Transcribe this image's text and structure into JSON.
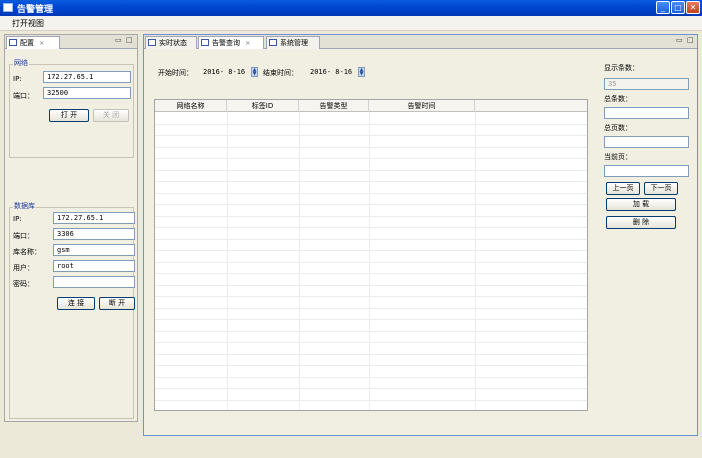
{
  "window": {
    "title": "告警管理",
    "minimize": "_",
    "maximize": "□",
    "close": "✕"
  },
  "menu": {
    "items": [
      "打开视图"
    ]
  },
  "left_panel": {
    "tab_label": "配置",
    "tab_close": "✕",
    "network": {
      "title": "网络",
      "ip_label": "IP:",
      "ip_value": "172.27.65.1",
      "port_label": "端口：",
      "port_value": "32500",
      "open_button": "打  开",
      "close_button": "关  闭"
    },
    "database": {
      "title": "数据库",
      "ip_label": "IP:",
      "ip_value": "172.27.65.1",
      "port_label": "端口：",
      "port_value": "3306",
      "dbname_label": "库名称：",
      "dbname_value": "gsm",
      "user_label": "用户：",
      "user_value": "root",
      "password_label": "密码：",
      "password_value": "",
      "connect_button": "连  接",
      "disconnect_button": "断  开"
    }
  },
  "main_panel": {
    "tabs": [
      {
        "label": "实时状态",
        "active": false
      },
      {
        "label": "告警查询",
        "active": true
      },
      {
        "label": "系统管理",
        "active": false
      }
    ],
    "tab_close": "✕",
    "query": {
      "start_label": "开始时间：",
      "start_value": "2016- 8-16",
      "end_label": "结束时间：",
      "end_value": "2016- 8-16",
      "spin_up": "▲",
      "spin_down": "▼"
    },
    "table": {
      "columns": [
        "网络名称",
        "标签ID",
        "告警类型",
        "告警时间",
        ""
      ]
    },
    "side": {
      "display_count_label": "显示条数：",
      "display_count_placeholder": "35",
      "total_count_label": "总条数：",
      "total_count_value": "",
      "total_pages_label": "总页数：",
      "total_pages_value": "",
      "current_page_label": "当前页：",
      "current_page_value": "",
      "prev_button": "上一页",
      "next_button": "下一页",
      "load_button": "加  载",
      "delete_button": "删  除"
    }
  },
  "panel_controls": {
    "minimize": "▭",
    "maximize": "□"
  }
}
